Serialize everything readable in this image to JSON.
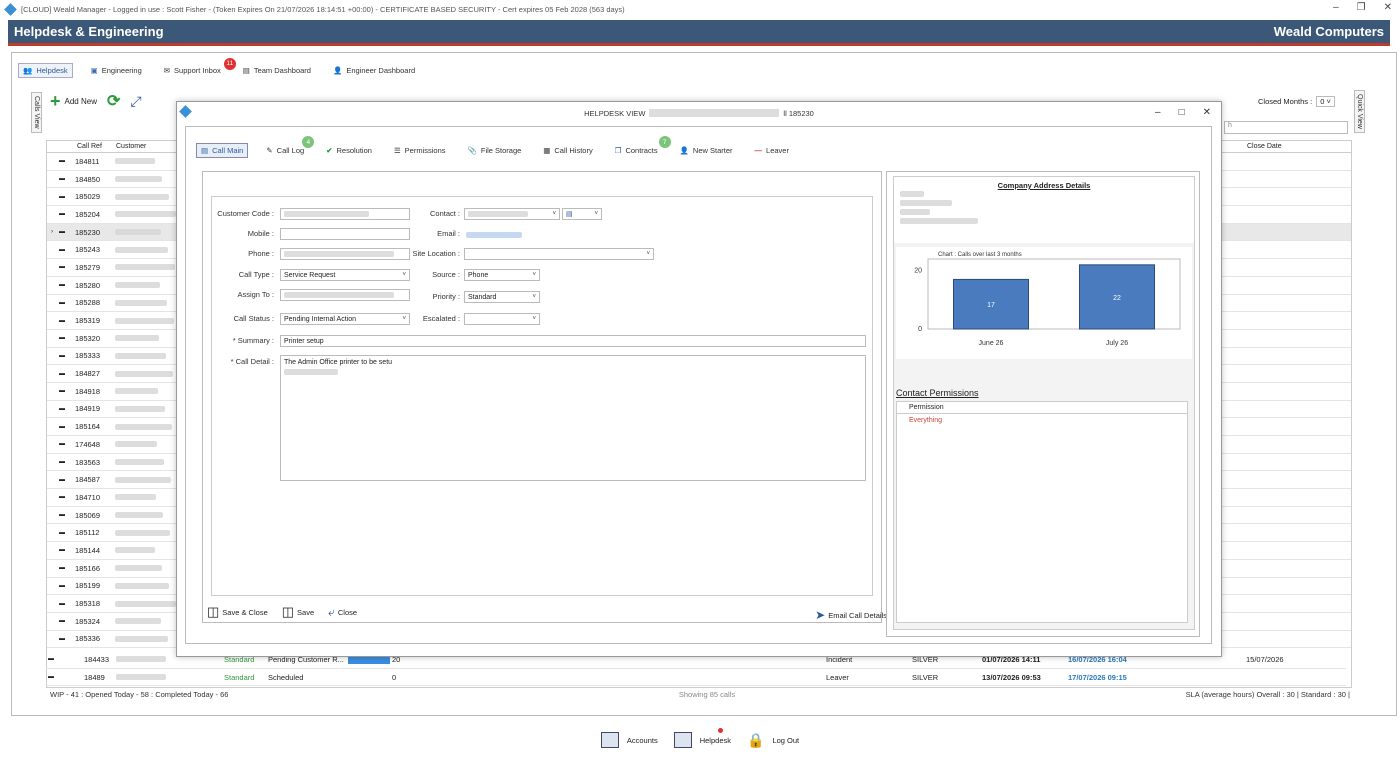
{
  "window": {
    "title": "[CLOUD]  Weald Manager - Logged in use : Scott Fisher - (Token Expires On 21/07/2026 18:14:51 +00:00) - CERTIFICATE BASED SECURITY - Cert expires 05 Feb 2028 (563 days)"
  },
  "header": {
    "left": "Helpdesk & Engineering",
    "right": "Weald Computers"
  },
  "main_tabs": [
    {
      "label": "Helpdesk"
    },
    {
      "label": "Engineering"
    },
    {
      "label": "Support Inbox",
      "badge": "11"
    },
    {
      "label": "Team Dashboard"
    },
    {
      "label": "Engineer Dashboard"
    }
  ],
  "toolbar": {
    "add_new": "Add New",
    "closed_months_label": "Closed Months :",
    "closed_months_value": "0"
  },
  "side": {
    "calls_view": "Calls View",
    "quick_view": "Quick View"
  },
  "grid": {
    "col_ref": "Call Ref",
    "col_customer": "Customer",
    "col_close": "Close Date",
    "refs": [
      "184811",
      "184850",
      "185029",
      "185204",
      "185230",
      "185243",
      "185279",
      "185280",
      "185288",
      "185319",
      "185320",
      "185333",
      "184827",
      "184918",
      "184919",
      "185164",
      "174648",
      "183563",
      "184587",
      "184710",
      "185069",
      "185112",
      "185144",
      "185166",
      "185199",
      "185318",
      "185324",
      "185336"
    ],
    "bottom_rows": [
      {
        "ref": "184433",
        "priority": "Standard",
        "status": "Pending Customer R...",
        "progress": "20",
        "type": "Incident",
        "level": "SILVER",
        "open": "01/07/2026 14:11",
        "due": "16/07/2026 16:04",
        "close": "15/07/2026"
      },
      {
        "ref": "18489",
        "priority": "Standard",
        "status": "Scheduled",
        "progress": "0",
        "type": "Leaver",
        "level": "SILVER",
        "open": "13/07/2026 09:53",
        "due": "17/07/2026 09:15",
        "close": ""
      }
    ]
  },
  "status_bar": {
    "left": "WIP - 41 : Opened Today - 58 : Completed Today - 66",
    "center": "Showing  85  calls",
    "right": "SLA (average hours)  Overall : 30 | Standard : 30 |"
  },
  "modal": {
    "title": "HELPDESK VIEW",
    "title_suffix": "ll 185230",
    "tabs": [
      {
        "label": "Call Main"
      },
      {
        "label": "Call Log",
        "badge": "4"
      },
      {
        "label": "Resolution"
      },
      {
        "label": "Permissions"
      },
      {
        "label": "File Storage"
      },
      {
        "label": "Call History"
      },
      {
        "label": "Contracts",
        "badge": "7"
      },
      {
        "label": "New Starter"
      },
      {
        "label": "Leaver"
      }
    ],
    "form": {
      "customer_code": "Customer Code :",
      "mobile": "Mobile :",
      "phone": "Phone :",
      "call_type": "Call Type :",
      "call_type_value": "Service Request",
      "assign_to": "Assign To :",
      "call_status": "Call Status :",
      "call_status_value": "Pending Internal Action",
      "contact": "Contact :",
      "email": "Email :",
      "site_location": "Site Location :",
      "source": "Source :",
      "source_value": "Phone",
      "priority": "Priority :",
      "priority_value": "Standard",
      "escalated": "Escalated :",
      "summary": "* Summary :",
      "summary_value": "Printer setup",
      "call_detail": "* Call Detail :",
      "call_detail_value": "The Admin Office printer to be setu"
    },
    "buttons": {
      "save_close": "Save & Close",
      "save": "Save",
      "close": "Close",
      "email": "Email Call Details"
    },
    "right": {
      "company_address_title": "Company Address Details",
      "contact_permissions": "Contact Permissions",
      "perm_header": "Permission",
      "perm_value": "Everything"
    }
  },
  "chart_data": {
    "type": "bar",
    "title": "Chart : Calls over last 3 months",
    "categories": [
      "June 26",
      "July 26"
    ],
    "values": [
      17,
      22
    ],
    "yticks": [
      0,
      20
    ],
    "ylim": [
      0,
      24
    ],
    "color": "#4a7bbf"
  },
  "footer": {
    "accounts": "Accounts",
    "helpdesk": "Helpdesk",
    "logout": "Log Out"
  }
}
